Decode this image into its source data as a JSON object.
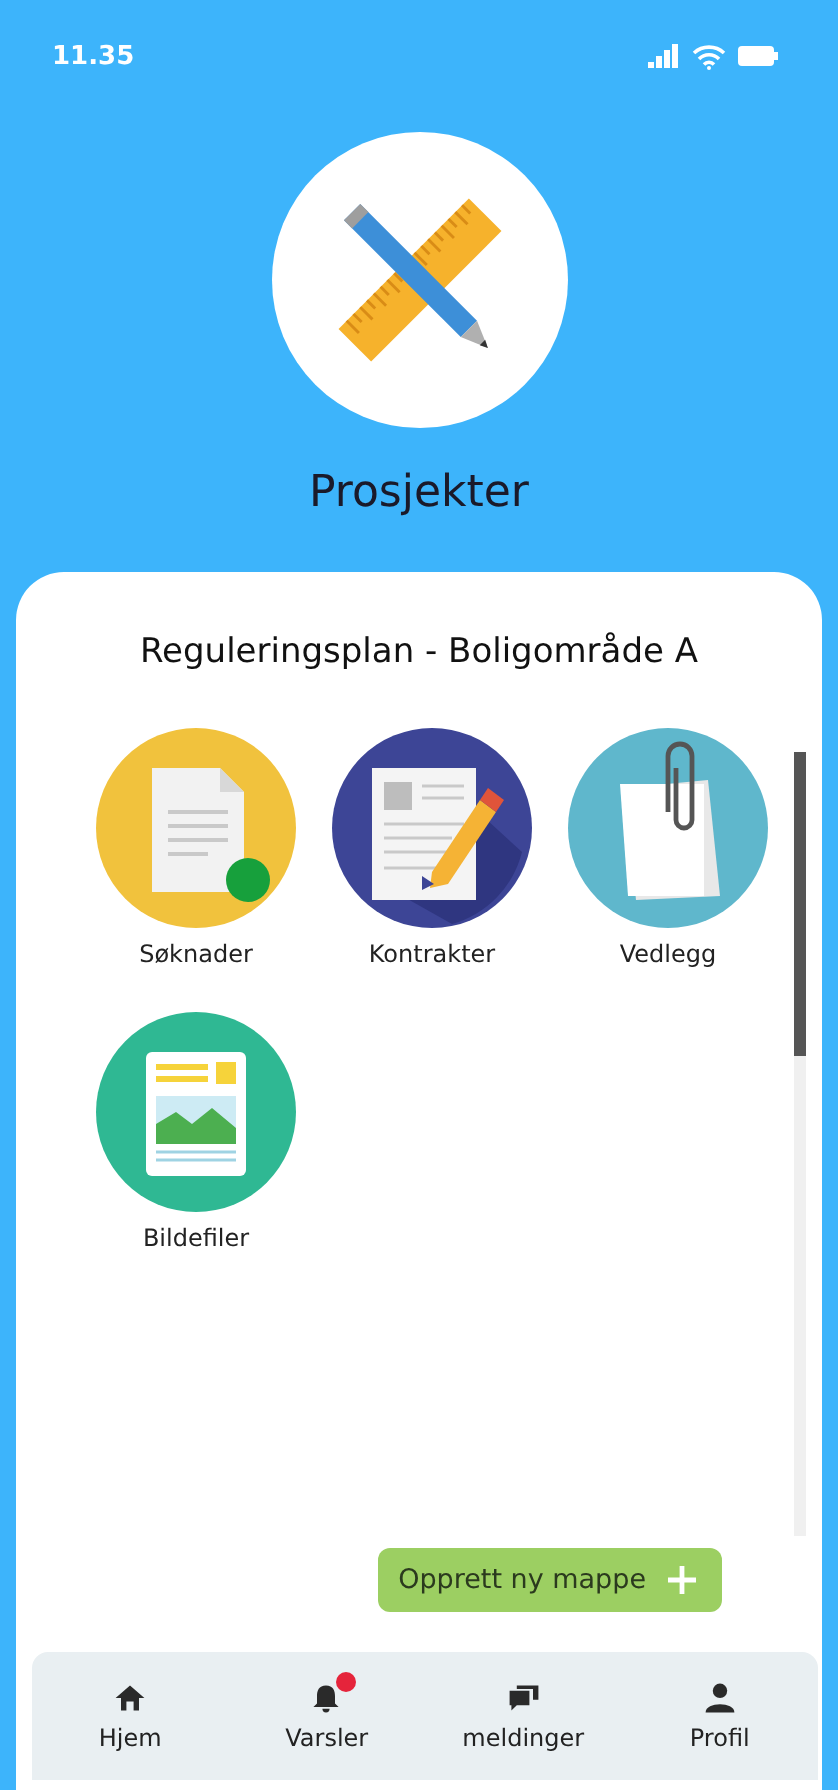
{
  "status_bar": {
    "time": "11.35"
  },
  "header": {
    "title": "Prosjekter"
  },
  "project": {
    "title": "Reguleringsplan - Boligområde A"
  },
  "folders": [
    {
      "label": "Søknader",
      "kind": "application"
    },
    {
      "label": "Kontrakter",
      "kind": "contract"
    },
    {
      "label": "Vedlegg",
      "kind": "attachment"
    },
    {
      "label": "Bildefiler",
      "kind": "image"
    }
  ],
  "create_button": {
    "label": "Opprett ny mappe"
  },
  "nav": [
    {
      "label": "Hjem",
      "kind": "home",
      "notification": false
    },
    {
      "label": "Varsler",
      "kind": "bell",
      "notification": true
    },
    {
      "label": "meldinger",
      "kind": "chat",
      "notification": false
    },
    {
      "label": "Profil",
      "kind": "person",
      "notification": false
    }
  ]
}
